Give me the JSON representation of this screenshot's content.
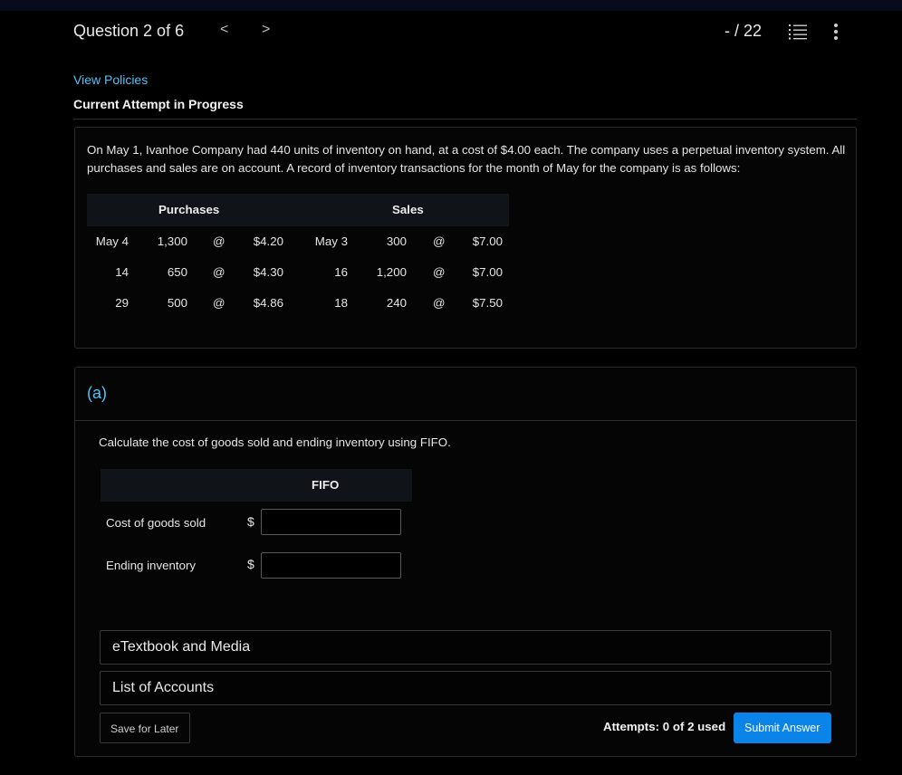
{
  "header": {
    "question_label": "Question 2 of 6",
    "prev_arrow": "<",
    "next_arrow": ">",
    "score": "- / 22",
    "list_icon": "list-view-icon",
    "more_icon": "more-vertical-icon"
  },
  "links": {
    "view_policies": "View Policies"
  },
  "status": {
    "attempt_label": "Current Attempt in Progress"
  },
  "problem": {
    "text": "On May 1, Ivanhoe Company had 440 units of inventory on hand, at a cost of $4.00 each. The company uses a perpetual inventory system. All purchases and sales are on account. A record of inventory transactions for the month of May for the company is as follows:",
    "table": {
      "purchases_header": "Purchases",
      "sales_header": "Sales",
      "rows": [
        {
          "p_date": "May 4",
          "p_units": "1,300",
          "p_at": "@",
          "p_cost": "$4.20",
          "s_date": "May 3",
          "s_units": "300",
          "s_at": "@",
          "s_price": "$7.00"
        },
        {
          "p_date": "14",
          "p_units": "650",
          "p_at": "@",
          "p_cost": "$4.30",
          "s_date": "16",
          "s_units": "1,200",
          "s_at": "@",
          "s_price": "$7.00"
        },
        {
          "p_date": "29",
          "p_units": "500",
          "p_at": "@",
          "p_cost": "$4.86",
          "s_date": "18",
          "s_units": "240",
          "s_at": "@",
          "s_price": "$7.50"
        }
      ]
    }
  },
  "part_a": {
    "label": "(a)",
    "instruction": "Calculate the cost of goods sold and ending inventory using FIFO.",
    "column_header": "FIFO",
    "currency": "$",
    "rows": [
      {
        "label": "Cost of goods sold",
        "value": ""
      },
      {
        "label": "Ending inventory",
        "value": ""
      }
    ],
    "etextbook": "eTextbook and Media",
    "list_of_accounts": "List of Accounts",
    "save_label": "Save for Later",
    "attempts": "Attempts: 0 of 2 used",
    "submit_label": "Submit Answer"
  },
  "colors": {
    "accent_link": "#4fc3f7",
    "submit_bg": "#0a84e8",
    "background": "#000000"
  }
}
